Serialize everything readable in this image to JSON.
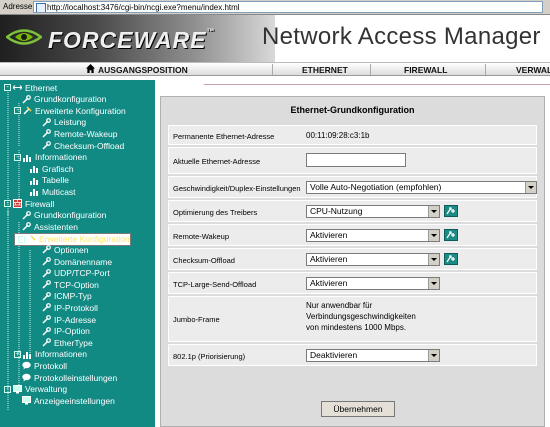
{
  "browser": {
    "address_label": "Adresse",
    "url": "http://localhost:3476/cgi-bin/ncgi.exe?menu/index.html"
  },
  "header": {
    "brand": "FORCEWARE",
    "brand_mark": "™",
    "title": "Network Access Manager"
  },
  "nav": {
    "home": "AUSGANGSPOSITION",
    "ethernet": "ETHERNET",
    "firewall": "FIREWALL",
    "verwaltung": "VERWAL"
  },
  "sidebar": {
    "items": [
      {
        "label": "Ethernet"
      },
      {
        "label": "Grundkonfiguration"
      },
      {
        "label": "Erweiterte Konfiguration"
      },
      {
        "label": "Leistung"
      },
      {
        "label": "Remote-Wakeup"
      },
      {
        "label": "Checksum-Offload"
      },
      {
        "label": "Informationen"
      },
      {
        "label": "Grafisch"
      },
      {
        "label": "Tabelle"
      },
      {
        "label": "Multicast"
      },
      {
        "label": "Firewall"
      },
      {
        "label": "Grundkonfiguration"
      },
      {
        "label": "Assistenten"
      },
      {
        "label": "Erweiterte Konfiguration"
      },
      {
        "label": "Optionen"
      },
      {
        "label": "Domänenname"
      },
      {
        "label": "UDP/TCP-Port"
      },
      {
        "label": "TCP-Option"
      },
      {
        "label": "ICMP-Typ"
      },
      {
        "label": "IP-Protokoll"
      },
      {
        "label": "IP-Adresse"
      },
      {
        "label": "IP-Option"
      },
      {
        "label": "EtherType"
      },
      {
        "label": "Informationen"
      },
      {
        "label": "Protokoll"
      },
      {
        "label": "Protokolleinstellungen"
      },
      {
        "label": "Verwaltung"
      },
      {
        "label": "Anzeigeeinstellungen"
      }
    ]
  },
  "panel": {
    "title": "Ethernet-Grundkonfiguration",
    "perm_mac_label": "Permanente Ethernet-Adresse",
    "perm_mac_value": "00:11:09:28:c3:1b",
    "cur_mac_label": "Aktuelle Ethernet-Adresse",
    "cur_mac_value": "",
    "speed_label": "Geschwindigkeit/Duplex-Einstellungen",
    "speed_value": "Volle Auto-Negotiation (empfohlen)",
    "opt_label": "Optimierung des Treibers",
    "opt_value": "CPU-Nutzung",
    "wake_label": "Remote-Wakeup",
    "wake_value": "Aktivieren",
    "csum_label": "Checksum-Offload",
    "csum_value": "Aktivieren",
    "tcp_label": "TCP-Large-Send-Offload",
    "tcp_value": "Aktivieren",
    "jumbo_label": "Jumbo-Frame",
    "jumbo_line1": "Nur anwendbar für",
    "jumbo_line2": "Verbindungsgeschwindigkeiten",
    "jumbo_line3": "von mindestens 1000 Mbps.",
    "prio_label": "802.1p (Priorisierung)",
    "prio_value": "Deaktivieren",
    "apply_label": "Übernehmen"
  }
}
